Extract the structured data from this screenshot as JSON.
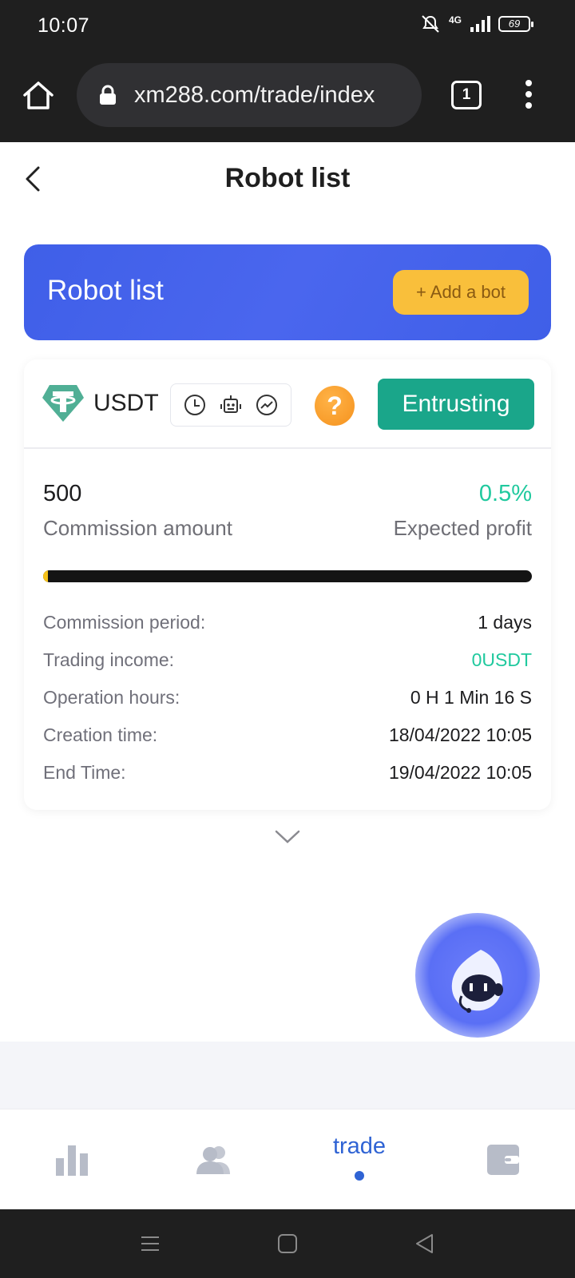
{
  "status_bar": {
    "time": "10:07",
    "network": "4G",
    "battery": "69"
  },
  "browser": {
    "url": "xm288.com/trade/index",
    "tab_count": "1"
  },
  "header": {
    "title": "Robot list"
  },
  "banner": {
    "title": "Robot list",
    "add_bot_label": "+ Add a bot"
  },
  "card": {
    "coin": "USDT",
    "help_label": "?",
    "status_label": "Entrusting",
    "amount_value": "500",
    "amount_label": "Commission amount",
    "profit_value": "0.5%",
    "profit_label": "Expected profit",
    "progress_fraction": 0.01,
    "details": [
      {
        "label": "Commission period:",
        "value": "1 days"
      },
      {
        "label": "Trading income:",
        "value": "0USDT"
      },
      {
        "label": "Operation hours:",
        "value": "0 H 1 Min 16 S"
      },
      {
        "label": "Creation time:",
        "value": "18/04/2022 10:05"
      },
      {
        "label": "End Time:",
        "value": "19/04/2022 10:05"
      }
    ]
  },
  "tabbar": {
    "items": [
      {
        "icon": "bar-chart-icon"
      },
      {
        "icon": "users-icon"
      },
      {
        "label": "trade",
        "active": true
      },
      {
        "icon": "wallet-icon"
      }
    ]
  },
  "colors": {
    "banner": "#4a66ee",
    "add_bot": "#f9bf3b",
    "entrusting": "#1aa68a",
    "profit_green": "#20c99e",
    "active_tab": "#2f63d4"
  }
}
